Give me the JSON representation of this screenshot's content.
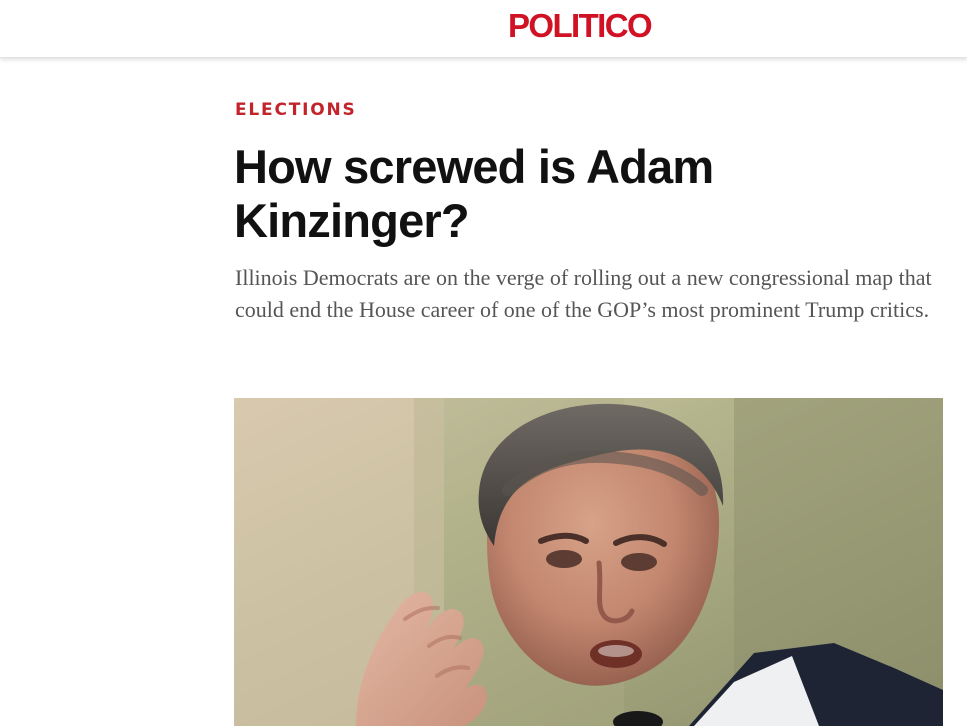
{
  "header": {
    "logo_text": "POLITICO"
  },
  "article": {
    "section": "ELECTIONS",
    "headline": "How screwed is Adam Kinzinger?",
    "dek": "Illinois Democrats are on the verge of rolling out a new congressional map that could end the House career of one of the GOP’s most prominent Trump critics."
  },
  "colors": {
    "brand_red": "#d11124",
    "kicker_red": "#c3232a",
    "headline": "#111111",
    "dek": "#555555"
  },
  "icons": {
    "photo": "lead-photo"
  }
}
